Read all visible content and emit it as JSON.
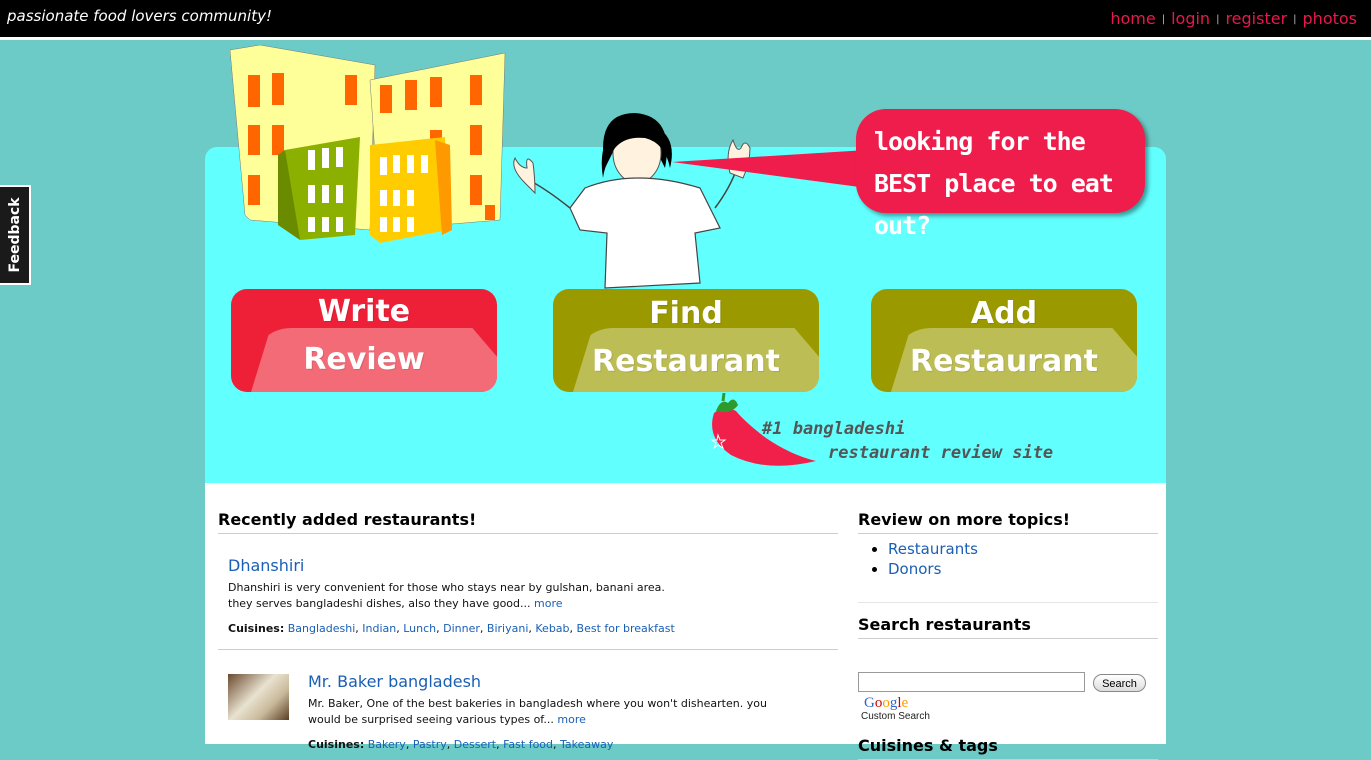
{
  "header": {
    "tagline": "passionate food lovers community!",
    "nav": [
      {
        "label": "home"
      },
      {
        "label": "login"
      },
      {
        "label": "register"
      },
      {
        "label": "photos"
      }
    ],
    "separator": "|"
  },
  "feedback": {
    "label": "Feedback"
  },
  "hero": {
    "bubble": "looking for the BEST place to eat out?",
    "buttons": {
      "write": {
        "line1": "Write",
        "line2": "Review"
      },
      "find": {
        "line1": "Find",
        "line2": "Restaurant"
      },
      "add": {
        "line1": "Add",
        "line2": "Restaurant"
      }
    },
    "slogan_line1": "#1 bangladeshi",
    "slogan_line2": "restaurant review site"
  },
  "recent": {
    "heading": "Recently added restaurants!",
    "items": [
      {
        "name": "Dhanshiri",
        "desc": "Dhanshiri is very convenient for those who stays near by gulshan, banani area. they serves bangladeshi dishes, also they have good...",
        "more": "more",
        "cuisines_label": "Cuisines:",
        "cuisines": [
          "Bangladeshi",
          "Indian",
          "Lunch",
          "Dinner",
          "Biriyani",
          "Kebab",
          "Best for breakfast"
        ]
      },
      {
        "name": "Mr. Baker bangladesh",
        "desc": "Mr. Baker, One of the best bakeries in bangladesh where you won't dishearten. you would be surprised seeing various types of...",
        "more": "more",
        "cuisines_label": "Cuisines:",
        "cuisines": [
          "Bakery",
          "Pastry",
          "Dessert",
          "Fast food",
          "Takeaway"
        ]
      }
    ]
  },
  "sidebar": {
    "topics_heading": "Review on more topics!",
    "topics": [
      "Restaurants",
      "Donors"
    ],
    "search_heading": "Search restaurants",
    "search_button": "Search",
    "google_label": "Google",
    "custom_search": "Custom Search",
    "cuisines_heading": "Cuisines & tags"
  },
  "colors": {
    "background": "#6ccbc6",
    "hero": "#62ffff",
    "accent_red": "#ee1d4c",
    "olive": "#9a9a00",
    "link": "#1a5fb4"
  }
}
